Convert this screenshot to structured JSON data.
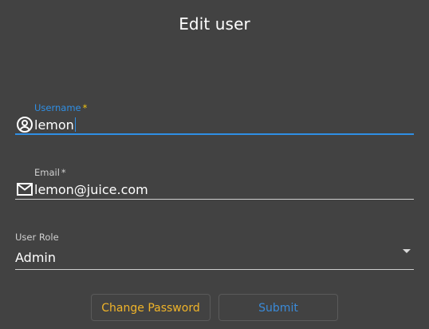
{
  "dialog": {
    "title": "Edit user"
  },
  "form": {
    "username": {
      "label": "Username",
      "required_mark": "*",
      "value": "lemon",
      "icon": "account-circle-icon"
    },
    "email": {
      "label": "Email",
      "required_mark": "*",
      "value": "lemon@juice.com",
      "icon": "mail-icon"
    },
    "role": {
      "label": "User Role",
      "value": "Admin"
    }
  },
  "actions": {
    "change_password_label": "Change Password",
    "submit_label": "Submit"
  },
  "colors": {
    "background": "#424242",
    "focus_accent": "#2f8fe5",
    "required_star_focused": "#f1c40f",
    "change_password_text": "#f0b429",
    "submit_text": "#3a8ad8"
  }
}
